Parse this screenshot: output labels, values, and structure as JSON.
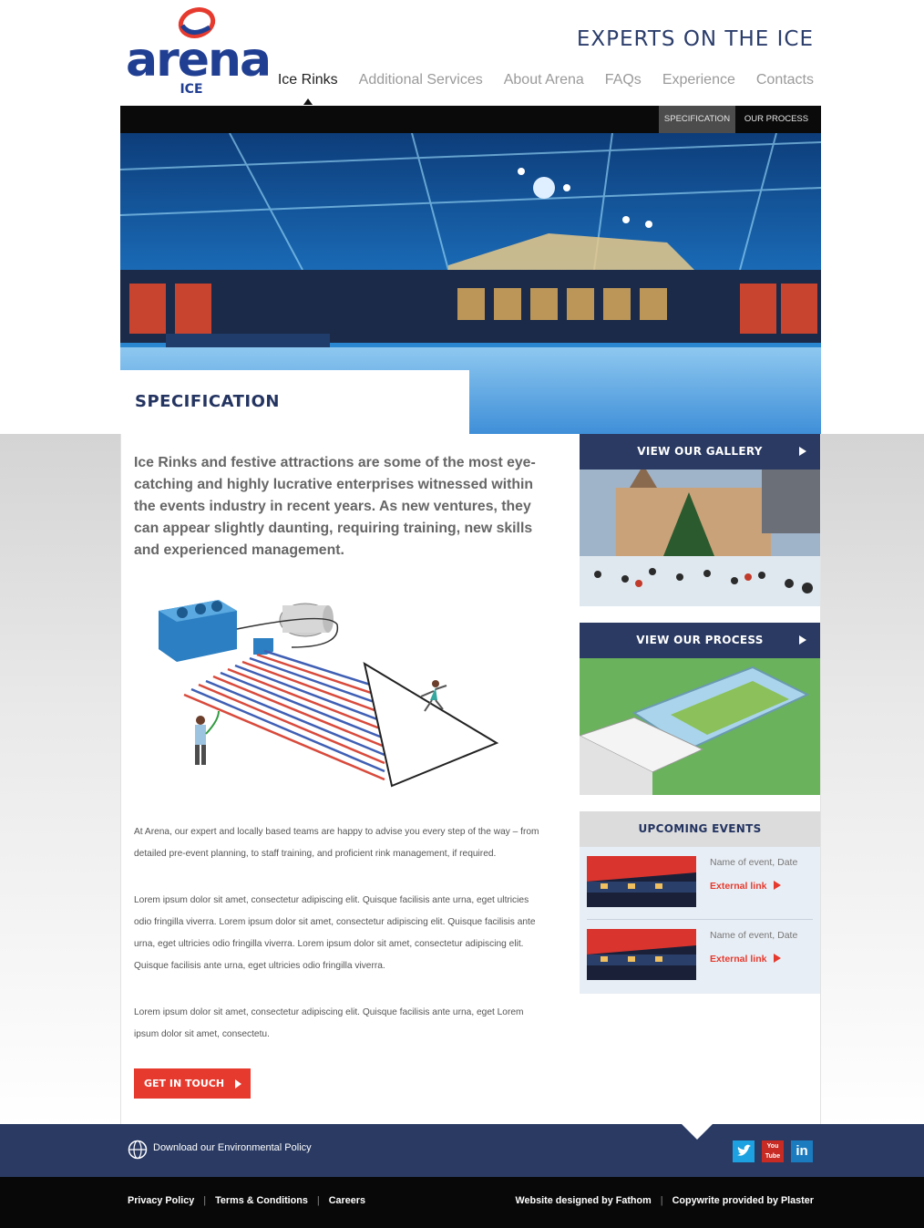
{
  "brand": {
    "logo_text": "arena",
    "logo_subtext": "ICE",
    "tagline": "EXPERTS ON THE ICE",
    "colors": {
      "navy": "#2a3a63",
      "logo_blue": "#213f92",
      "accent_red": "#e63a2e"
    }
  },
  "nav": {
    "items": [
      {
        "label": "Ice Rinks",
        "active": true
      },
      {
        "label": "Additional Services"
      },
      {
        "label": "About Arena"
      },
      {
        "label": "FAQs"
      },
      {
        "label": "Experience"
      },
      {
        "label": "Contacts"
      }
    ]
  },
  "subnav": {
    "specification": "SPECIFICATION",
    "process": "OUR PROCESS"
  },
  "hero": {
    "title": "SPECIFICATION"
  },
  "main": {
    "intro": "Ice Rinks and festive attractions are some of the most eye-catching and highly lucrative enterprises witnessed within the events industry in recent years.  As new ventures, they can appear slightly daunting, requiring training, new skills and experienced management.",
    "paragraph1": "At Arena, our expert and locally based teams are happy to advise you every step of the way – from detailed pre-event planning, to staff training, and proficient rink management, if required.",
    "paragraph2": "Lorem ipsum dolor sit amet, consectetur adipiscing elit. Quisque facilisis ante urna, eget ultricies odio fringilla viverra. Lorem ipsum dolor sit amet, consectetur adipiscing elit. Quisque facilisis ante urna, eget ultricies odio fringilla viverra. Lorem ipsum dolor sit amet, consectetur adipiscing elit. Quisque facilisis ante urna, eget ultricies odio fringilla viverra.",
    "paragraph3": "Lorem ipsum dolor sit amet, consectetur adipiscing elit. Quisque facilisis ante urna, eget  Lorem ipsum dolor sit amet, consectetu.",
    "cta_label": "GET IN TOUCH"
  },
  "sidebar": {
    "gallery_label": "VIEW OUR GALLERY",
    "process_label": "VIEW OUR PROCESS",
    "events_title": "UPCOMING EVENTS",
    "events": [
      {
        "name": "Name of event, Date",
        "link": "External link"
      },
      {
        "name": "Name of event, Date",
        "link": "External link"
      }
    ]
  },
  "footer": {
    "env_policy": "Download our Environmental Policy",
    "social": [
      "twitter-icon",
      "youtube-icon",
      "linkedin-icon"
    ],
    "youtube_text": "You Tube",
    "linkedin_text": "in",
    "links": [
      "Privacy Policy",
      "Terms & Conditions",
      "Careers"
    ],
    "credit_design": "Website designed by Fathom",
    "credit_copy": "Copywrite provided by Plaster"
  }
}
